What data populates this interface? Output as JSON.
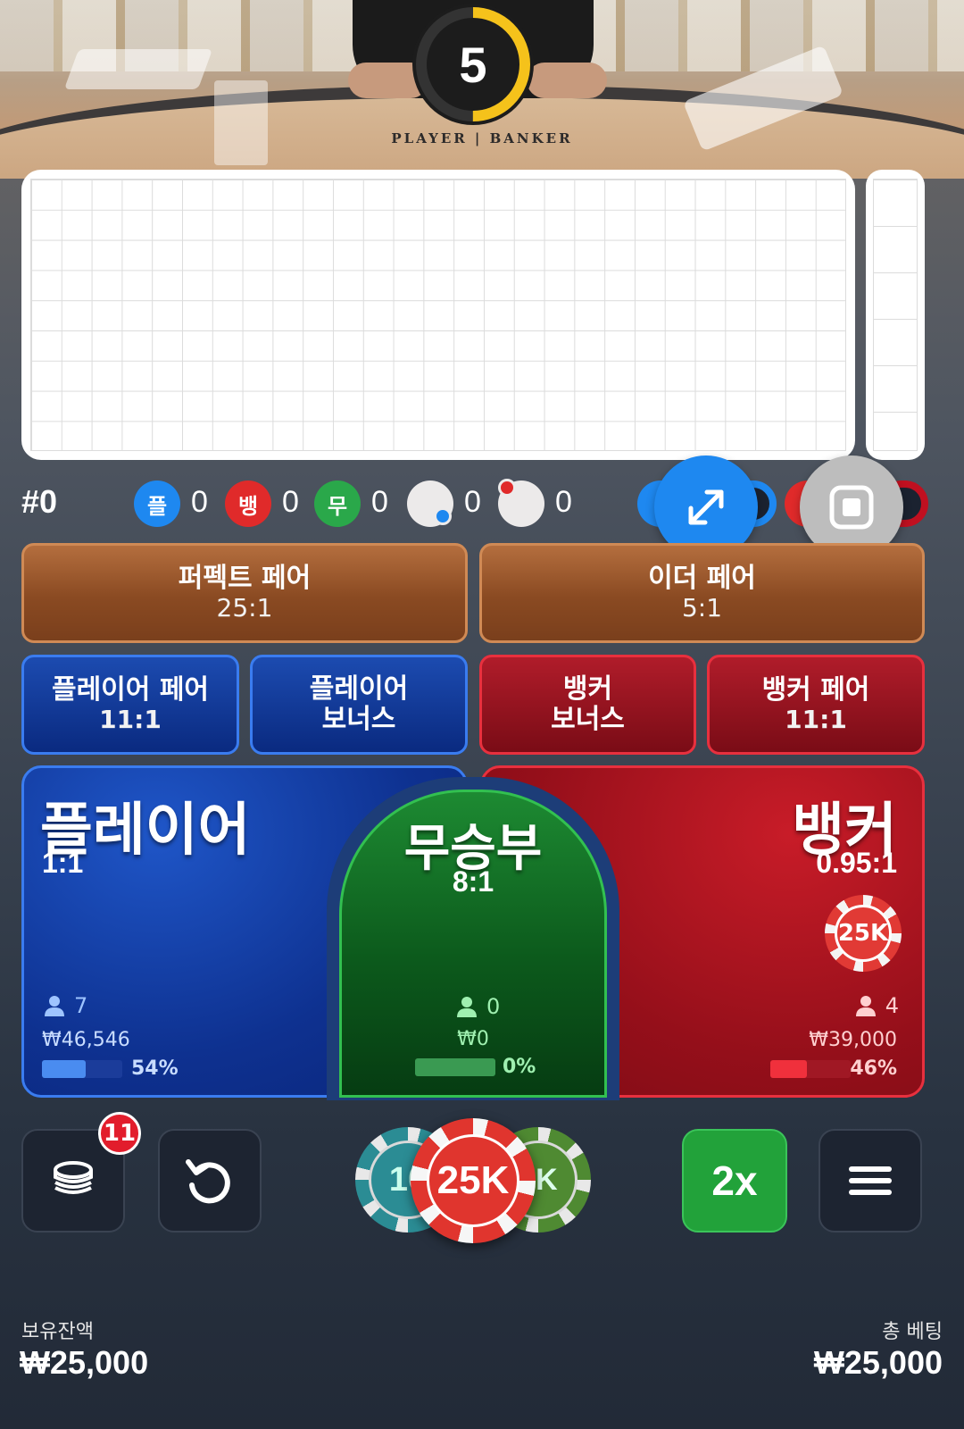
{
  "video": {
    "table_label": "PLAYER | BANKER",
    "timer": 5,
    "timer_fraction": 0.5
  },
  "stats": {
    "round": "#0",
    "player": {
      "label": "플",
      "count": "0",
      "color": "#1e88f0"
    },
    "banker": {
      "label": "뱅",
      "count": "0",
      "color": "#e02a2a"
    },
    "tie": {
      "label": "무",
      "count": "0",
      "color": "#2aa84a"
    },
    "player_pair": {
      "count": "0"
    },
    "banker_pair": {
      "count": "0"
    }
  },
  "side_bets": {
    "perfect_pair": {
      "label": "퍼펙트 페어",
      "odds": "25:1"
    },
    "either_pair": {
      "label": "이더 페어",
      "odds": "5:1"
    },
    "player_pair": {
      "label": "플레이어 페어",
      "odds": "11:1"
    },
    "player_bonus": {
      "label1": "플레이어",
      "label2": "보너스"
    },
    "banker_bonus": {
      "label1": "뱅커",
      "label2": "보너스"
    },
    "banker_pair": {
      "label": "뱅커 페어",
      "odds": "11:1"
    }
  },
  "main_bets": {
    "player": {
      "label": "플레이어",
      "odds": "1:1",
      "players": "7",
      "amount": "₩46,546",
      "percent": "54%",
      "fraction": 0.54
    },
    "tie": {
      "label": "무승부",
      "odds": "8:1",
      "players": "0",
      "amount": "₩0",
      "percent": "0%",
      "fraction": 0.0
    },
    "banker": {
      "label": "뱅커",
      "odds": "0.95:1",
      "players": "4",
      "amount": "₩39,000",
      "percent": "46%",
      "fraction": 0.46,
      "placed_chip": "25K"
    }
  },
  "controls": {
    "chip_stack_badge": "11",
    "chips": [
      "10",
      "25K",
      "5K"
    ],
    "double_label": "2x"
  },
  "footer": {
    "balance_label": "보유잔액",
    "balance_value": "₩25,000",
    "total_bet_label": "총 베팅",
    "total_bet_value": "₩25,000"
  },
  "colors": {
    "player_blue": "#1e88f0",
    "banker_red": "#e02a2a",
    "tie_green": "#2aa84a",
    "timer_yellow": "#f5c21b"
  }
}
